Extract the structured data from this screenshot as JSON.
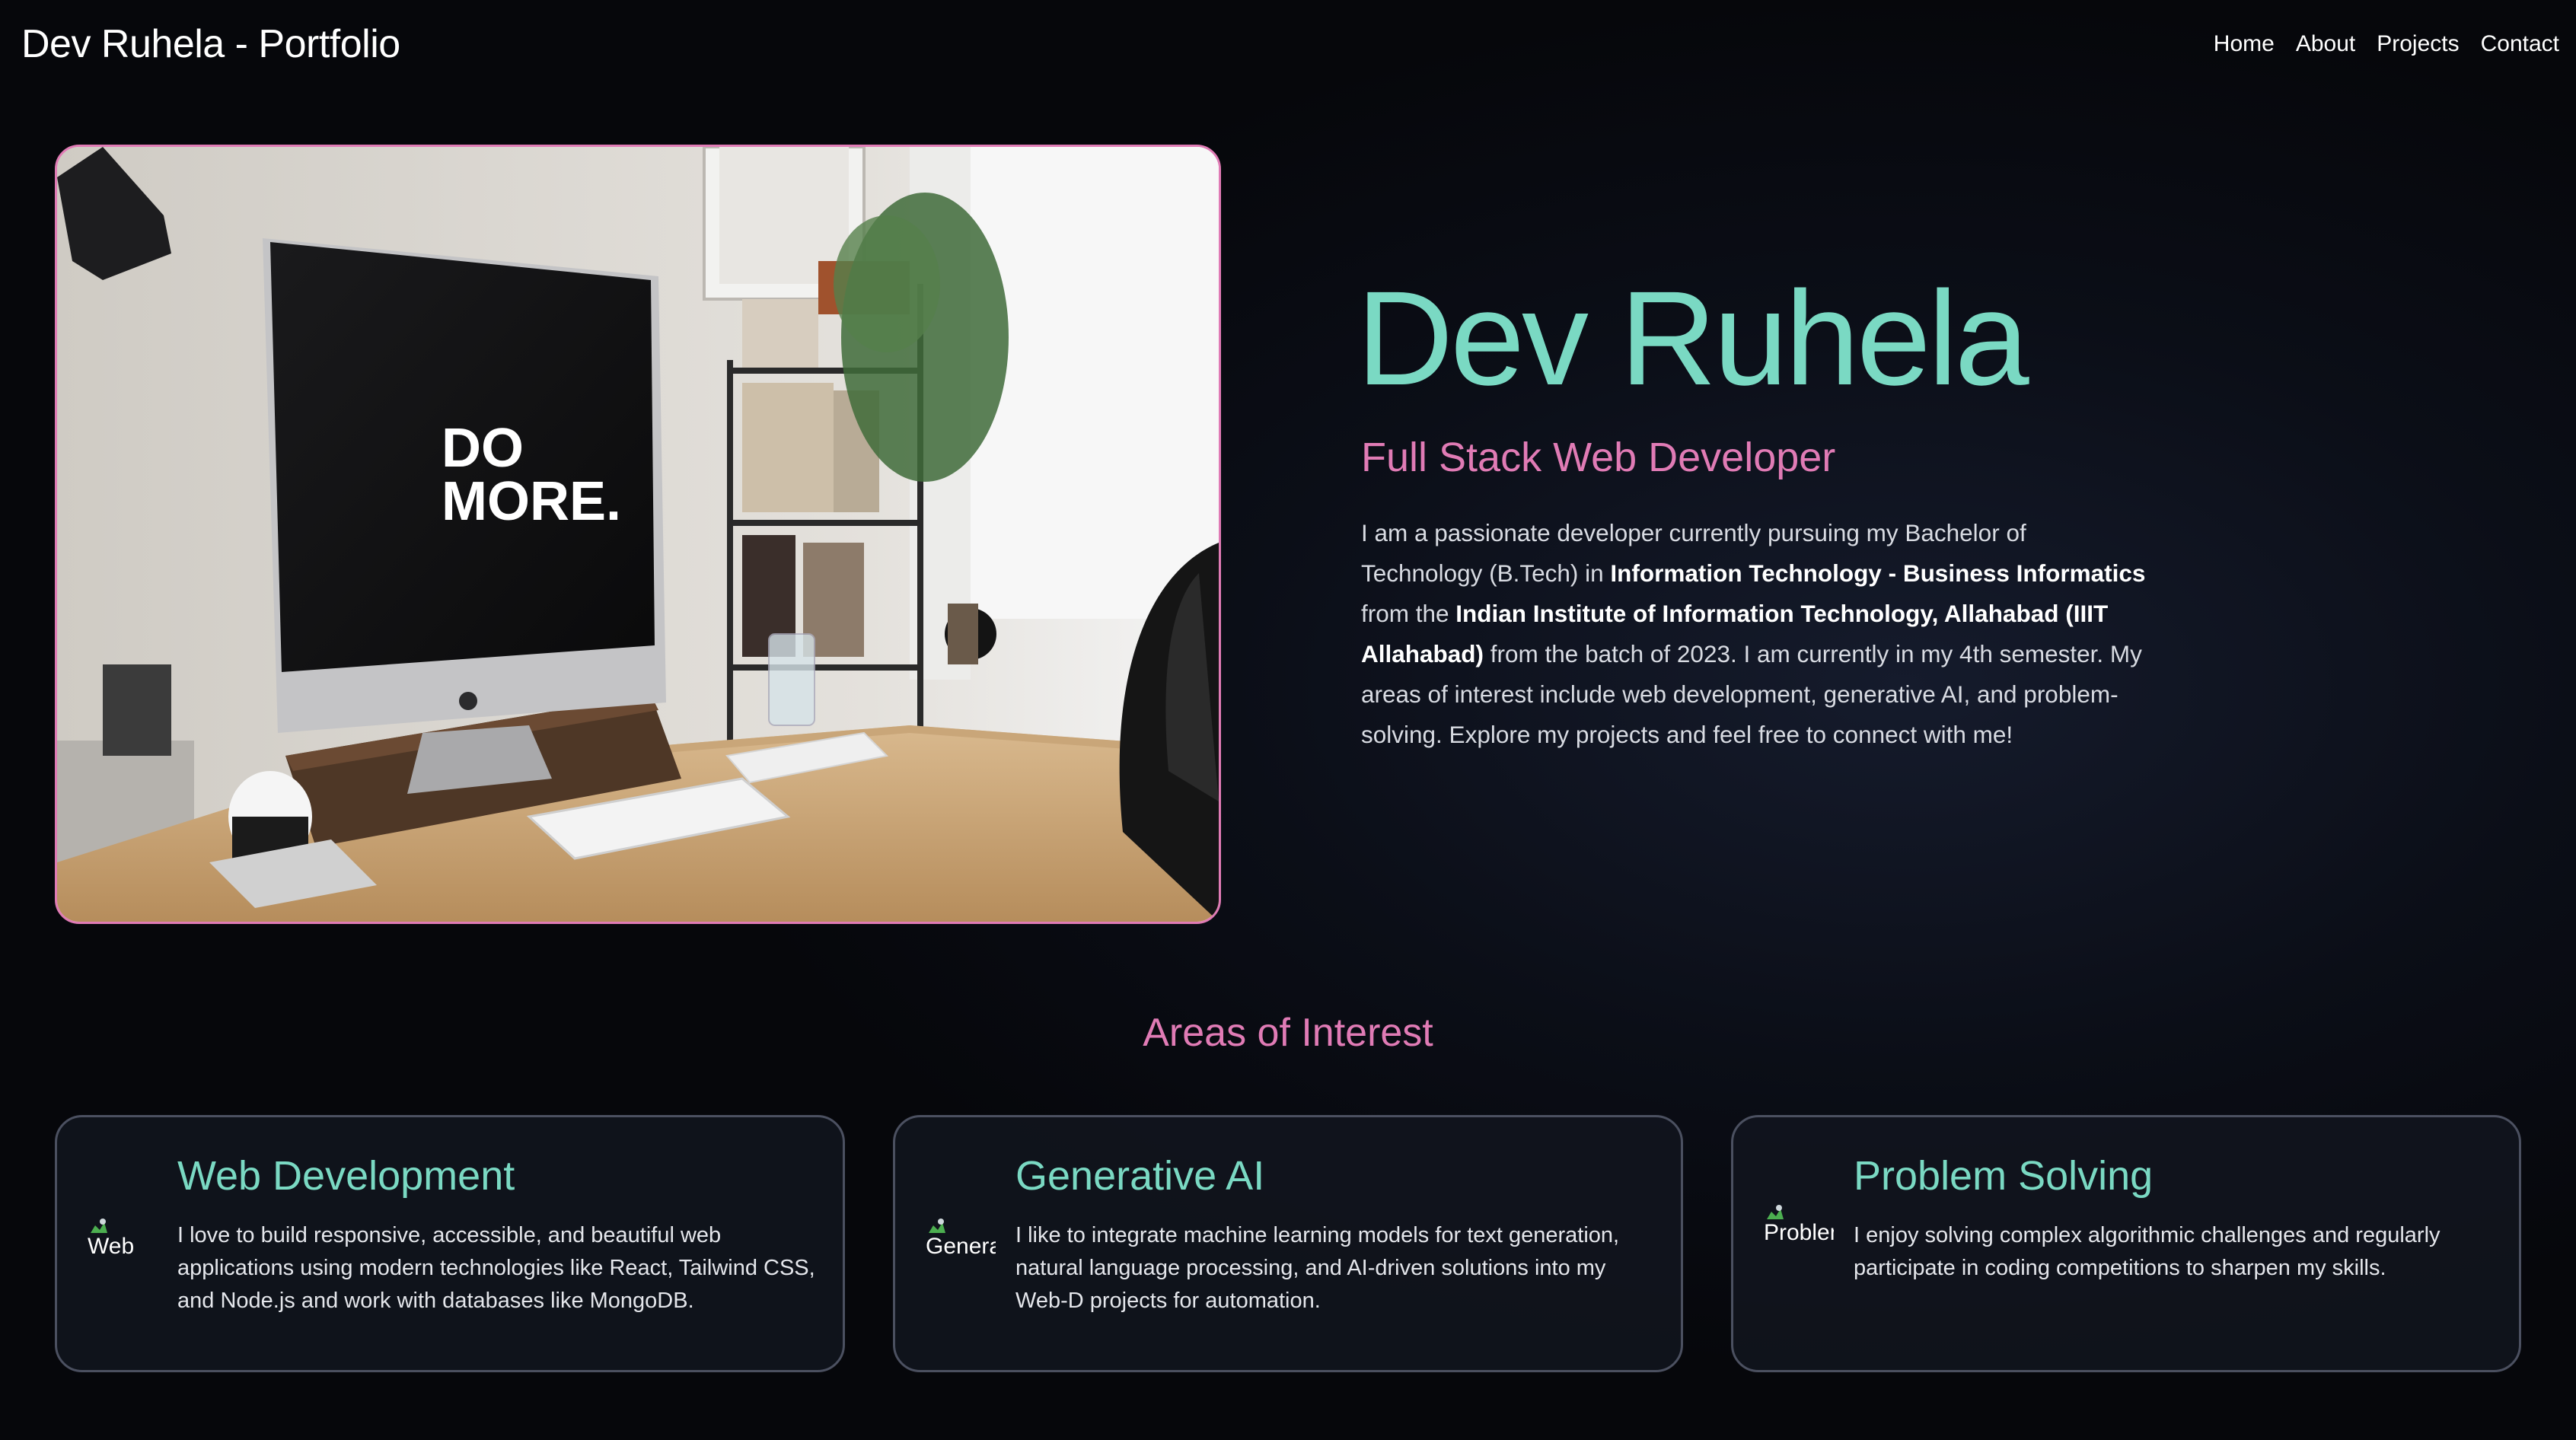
{
  "navbar": {
    "brand": "Dev Ruhela - Portfolio",
    "links": [
      "Home",
      "About",
      "Projects",
      "Contact"
    ]
  },
  "hero": {
    "name": "Dev Ruhela",
    "role": "Full Stack Web Developer",
    "bio": {
      "part1": "I am a passionate developer currently pursuing my Bachelor of Technology (B.Tech) in ",
      "bold1": "Information Technology - Business Informatics",
      "part2": " from the ",
      "bold2": "Indian Institute of Information Technology, Allahabad (IIIT Allahabad)",
      "part3": " from the batch of 2023. I am currently in my 4th semester. My areas of interest include web development, generative AI, and problem-solving. Explore my projects and feel free to connect with me!"
    },
    "image_screen_text": [
      "DO",
      "MORE."
    ]
  },
  "areas": {
    "title": "Areas of Interest",
    "cards": [
      {
        "icon_alt": "Web",
        "title": "Web Development",
        "description": "I love to build responsive, accessible, and beautiful web applications using modern technologies like React, Tailwind CSS, and Node.js and work with databases like MongoDB."
      },
      {
        "icon_alt": "Generative AI",
        "title": "Generative AI",
        "description": "I like to integrate machine learning models for text generation, natural language processing, and AI-driven solutions into my Web-D projects for automation."
      },
      {
        "icon_alt": "Problem Solving",
        "title": "Problem Solving",
        "description": "I enjoy solving complex algorithmic challenges and regularly participate in coding competitions to sharpen my skills."
      }
    ]
  },
  "colors": {
    "accent_teal": "#7ad9c3",
    "accent_pink": "#e07bb5",
    "background": "#0b0e17",
    "card_border": "#4b5060"
  }
}
